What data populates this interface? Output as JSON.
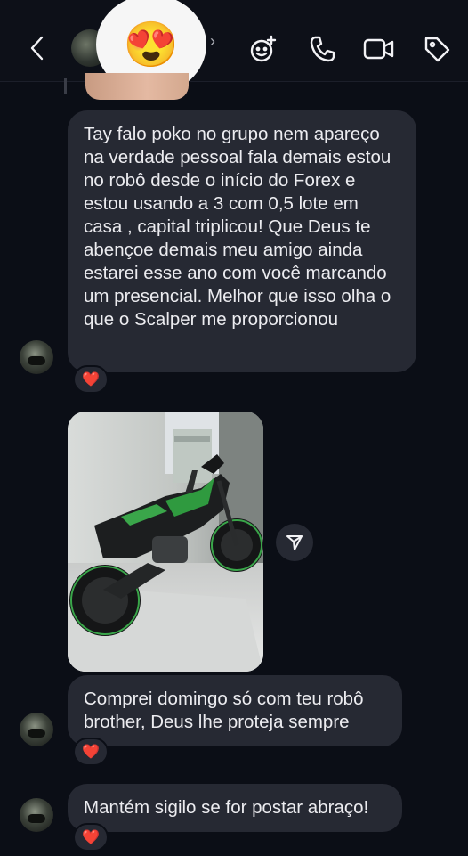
{
  "header": {
    "back_icon": "chevron-left-icon",
    "reaction_emoji": "😍",
    "chevron": "›",
    "actions": [
      "effects-icon",
      "phone-icon",
      "video-icon",
      "tag-icon"
    ]
  },
  "messages": [
    {
      "text": "Tay falo poko no grupo nem apareço na verdade pessoal fala demais estou no robô desde o início do Forex e estou usando a 3 com 0,5 lote em casa , capital triplicou! Que Deus te abençoe demais meu amigo ainda estarei esse ano com você marcando um presencial. Melhor que isso olha o que o Scalper me proporcionou",
      "reaction": "❤️"
    },
    {
      "type": "photo",
      "subject": "motorcycle-photo",
      "share_icon": "send-icon"
    },
    {
      "text": "Comprei domingo só com teu robô brother, Deus lhe proteja sempre",
      "reaction": "❤️"
    },
    {
      "text": "Mantém sigilo se for postar abraço!",
      "reaction": "❤️"
    }
  ],
  "colors": {
    "background": "#0b0e16",
    "bubble": "#262933",
    "heart": "#e63347",
    "bike_accent": "#3aa64a"
  }
}
